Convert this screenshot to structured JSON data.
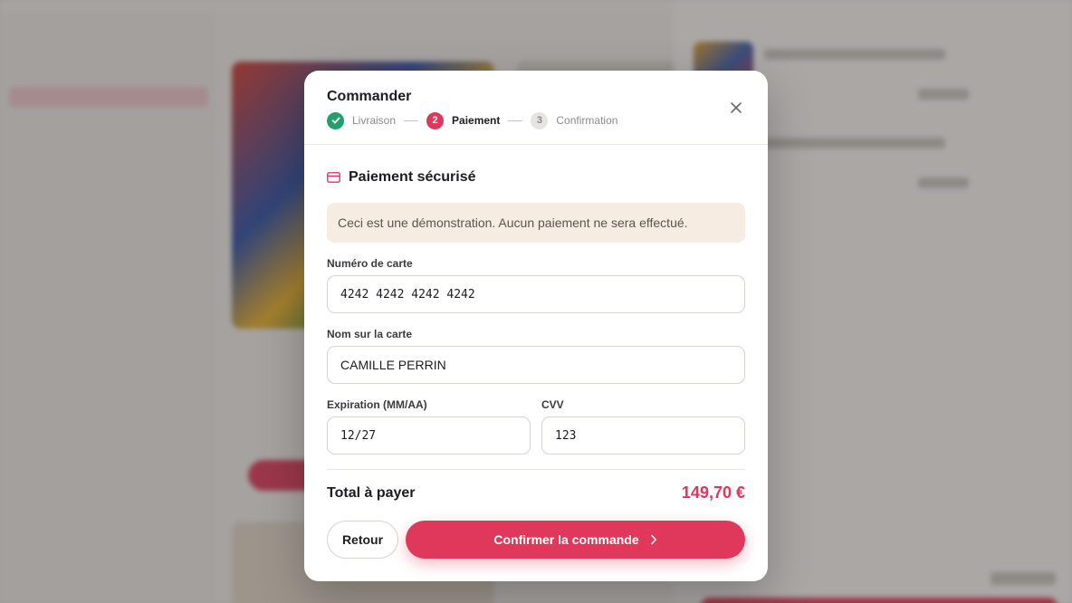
{
  "modal": {
    "title": "Commander",
    "steps": [
      {
        "number": "1",
        "label": "Livraison",
        "state": "done"
      },
      {
        "number": "2",
        "label": "Paiement",
        "state": "active"
      },
      {
        "number": "3",
        "label": "Confirmation",
        "state": "todo"
      }
    ],
    "section_title": "Paiement sécurisé",
    "notice": "Ceci est une démonstration. Aucun paiement ne sera effectué.",
    "card_number": {
      "label": "Numéro de carte",
      "value": "4242 4242 4242 4242"
    },
    "card_name": {
      "label": "Nom sur la carte",
      "value": "CAMILLE PERRIN"
    },
    "expiry": {
      "label": "Expiration (MM/AA)",
      "value": "12/27"
    },
    "cvv": {
      "label": "CVV",
      "value": "123"
    },
    "total_label": "Total à payer",
    "total_value": "149,70 €",
    "back_label": "Retour",
    "confirm_label": "Confirmer la commande"
  },
  "colors": {
    "accent": "#e0385a",
    "success": "#22a06b",
    "notice_bg": "#f6ece2"
  },
  "icons": {
    "close": "close-icon",
    "check": "check-icon",
    "card": "credit-card-icon",
    "chevron": "chevron-right-icon"
  }
}
